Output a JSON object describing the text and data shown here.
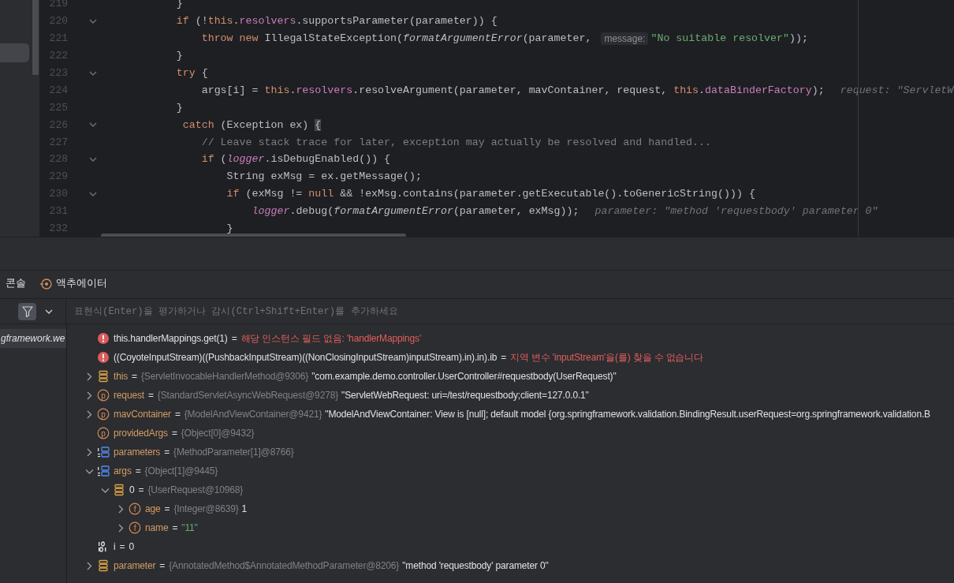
{
  "editor": {
    "lines": [
      {
        "number": "219",
        "foldable": false,
        "tokens": [
          {
            "kind": "plain",
            "text": "            }"
          }
        ]
      },
      {
        "number": "220",
        "foldable": true,
        "tokens": [
          {
            "kind": "keyword",
            "text": "            if"
          },
          {
            "kind": "plain",
            "text": " (!"
          },
          {
            "kind": "keyword",
            "text": "this"
          },
          {
            "kind": "plain",
            "text": "."
          },
          {
            "kind": "field",
            "text": "resolvers"
          },
          {
            "kind": "plain",
            "text": ".supportsParameter(parameter)) {"
          }
        ]
      },
      {
        "number": "221",
        "foldable": false,
        "tokens": [
          {
            "kind": "keyword",
            "text": "                throw new"
          },
          {
            "kind": "plain",
            "text": " IllegalStateException("
          },
          {
            "kind": "method",
            "text": "formatArgumentError"
          },
          {
            "kind": "plain",
            "text": "(parameter, "
          },
          {
            "kind": "param-hint",
            "text": "message:"
          },
          {
            "kind": "string",
            "text": "\"No suitable resolver\""
          },
          {
            "kind": "plain",
            "text": "));"
          }
        ]
      },
      {
        "number": "222",
        "foldable": false,
        "tokens": [
          {
            "kind": "plain",
            "text": "            }"
          }
        ]
      },
      {
        "number": "223",
        "foldable": true,
        "tokens": [
          {
            "kind": "keyword",
            "text": "            try"
          },
          {
            "kind": "plain",
            "text": " {"
          }
        ]
      },
      {
        "number": "224",
        "foldable": false,
        "tokens": [
          {
            "kind": "plain",
            "text": "                args[i] = "
          },
          {
            "kind": "keyword",
            "text": "this"
          },
          {
            "kind": "plain",
            "text": "."
          },
          {
            "kind": "field",
            "text": "resolvers"
          },
          {
            "kind": "plain",
            "text": ".resolveArgument(parameter, mavContainer, request, "
          },
          {
            "kind": "keyword",
            "text": "this"
          },
          {
            "kind": "plain",
            "text": "."
          },
          {
            "kind": "field",
            "text": "dataBinderFactory"
          },
          {
            "kind": "plain",
            "text": ");"
          },
          {
            "kind": "value-hint",
            "text": "request: \"ServletW"
          }
        ]
      },
      {
        "number": "225",
        "foldable": false,
        "tokens": [
          {
            "kind": "plain",
            "text": "            }"
          }
        ]
      },
      {
        "number": "226",
        "foldable": true,
        "tokens": [
          {
            "kind": "keyword",
            "text": "             catch"
          },
          {
            "kind": "plain",
            "text": " (Exception ex) "
          },
          {
            "kind": "brace-match",
            "text": "{"
          }
        ]
      },
      {
        "number": "227",
        "foldable": false,
        "tokens": [
          {
            "kind": "comment",
            "text": "                // Leave stack trace for later, exception may actually be resolved and handled..."
          }
        ]
      },
      {
        "number": "228",
        "foldable": true,
        "tokens": [
          {
            "kind": "keyword",
            "text": "                if"
          },
          {
            "kind": "plain",
            "text": " ("
          },
          {
            "kind": "static",
            "text": "logger"
          },
          {
            "kind": "plain",
            "text": ".isDebugEnabled()) {"
          }
        ]
      },
      {
        "number": "229",
        "foldable": false,
        "tokens": [
          {
            "kind": "plain",
            "text": "                    String exMsg = ex.getMessage();"
          }
        ]
      },
      {
        "number": "230",
        "foldable": true,
        "tokens": [
          {
            "kind": "keyword",
            "text": "                    if"
          },
          {
            "kind": "plain",
            "text": " (exMsg != "
          },
          {
            "kind": "keyword",
            "text": "null"
          },
          {
            "kind": "plain",
            "text": " && !exMsg.contains(parameter.getExecutable().toGenericString())) {"
          }
        ]
      },
      {
        "number": "231",
        "foldable": false,
        "tokens": [
          {
            "kind": "static",
            "text": "                        logger"
          },
          {
            "kind": "plain",
            "text": ".debug("
          },
          {
            "kind": "method",
            "text": "formatArgumentError"
          },
          {
            "kind": "plain",
            "text": "(parameter, exMsg));"
          },
          {
            "kind": "value-hint",
            "text": "parameter: \"method 'requestbody' parameter 0\""
          }
        ]
      },
      {
        "number": "232",
        "foldable": false,
        "tokens": [
          {
            "kind": "plain",
            "text": "                    }"
          }
        ]
      }
    ]
  },
  "debug": {
    "tabs": [
      {
        "label": "콘솔",
        "has_icon": false,
        "selected": false
      },
      {
        "label": "액추에이터",
        "has_icon": true,
        "selected": false
      }
    ],
    "filter_button": {
      "on": true
    },
    "eval_field": {
      "placeholder": "표현식(Enter)을 평가하거나 감시(Ctrl+Shift+Enter)를 추가하세요"
    },
    "frames": [
      {
        "label": "gframework.we",
        "selected": true
      }
    ],
    "variables": [
      {
        "kind": "error",
        "name": "this.handlerMappings.get(1)",
        "operator": "=",
        "value": "해당 인스턴스 필드 없음: 'handlerMappings'"
      },
      {
        "kind": "error",
        "name": "((CoyoteInputStream)((PushbackInputStream)((NonClosingInputStream)inputStream).in).in).ib",
        "operator": "=",
        "value": "지역 변수 'inputStream'을(를) 찾을 수 없습니다"
      },
      {
        "kind": "object",
        "expanded": false,
        "name": "this",
        "operator": "=",
        "type": "{ServletInvocableHandlerMethod@9306}",
        "value": "\"com.example.demo.controller.UserController#requestbody(UserRequest)\""
      },
      {
        "kind": "param",
        "icon_text": "p",
        "expanded": false,
        "name": "request",
        "operator": "=",
        "type": "{StandardServletAsyncWebRequest@9278}",
        "value": "\"ServletWebRequest: uri=/test/requestbody;client=127.0.0.1\""
      },
      {
        "kind": "param",
        "icon_text": "p",
        "expanded": false,
        "name": "mavContainer",
        "operator": "=",
        "type": "{ModelAndViewContainer@9421}",
        "value": "\"ModelAndViewContainer: View is [null]; default model {org.springframework.validation.BindingResult.userRequest=org.springframework.validation.B"
      },
      {
        "kind": "param",
        "icon_text": "p",
        "name": "providedArgs",
        "operator": "=",
        "type": "{Object[0]@9432}"
      },
      {
        "kind": "array",
        "expanded": false,
        "name": "parameters",
        "operator": "=",
        "type": "{MethodParameter[1]@8766}"
      },
      {
        "kind": "array",
        "expanded": true,
        "name": "args",
        "operator": "=",
        "type": "{Object[1]@9445}",
        "children": [
          {
            "kind": "element",
            "expanded": true,
            "name": "0",
            "operator": "=",
            "type": "{UserRequest@10968}",
            "children": [
              {
                "kind": "field",
                "icon_text": "f",
                "expanded": false,
                "name": "age",
                "operator": "=",
                "type": "{Integer@8639}",
                "value": "1"
              },
              {
                "kind": "field",
                "icon_text": "f",
                "expanded": false,
                "name": "name",
                "operator": "=",
                "value": "\"11\"",
                "value_is_string": true
              }
            ]
          }
        ]
      },
      {
        "kind": "primitive",
        "name": "i",
        "operator": "=",
        "value": "0"
      },
      {
        "kind": "object",
        "expanded": false,
        "name": "parameter",
        "operator": "=",
        "type": "{AnnotatedMethod$AnnotatedMethodParameter@8206}",
        "value": "\"method 'requestbody' parameter 0\""
      }
    ]
  }
}
